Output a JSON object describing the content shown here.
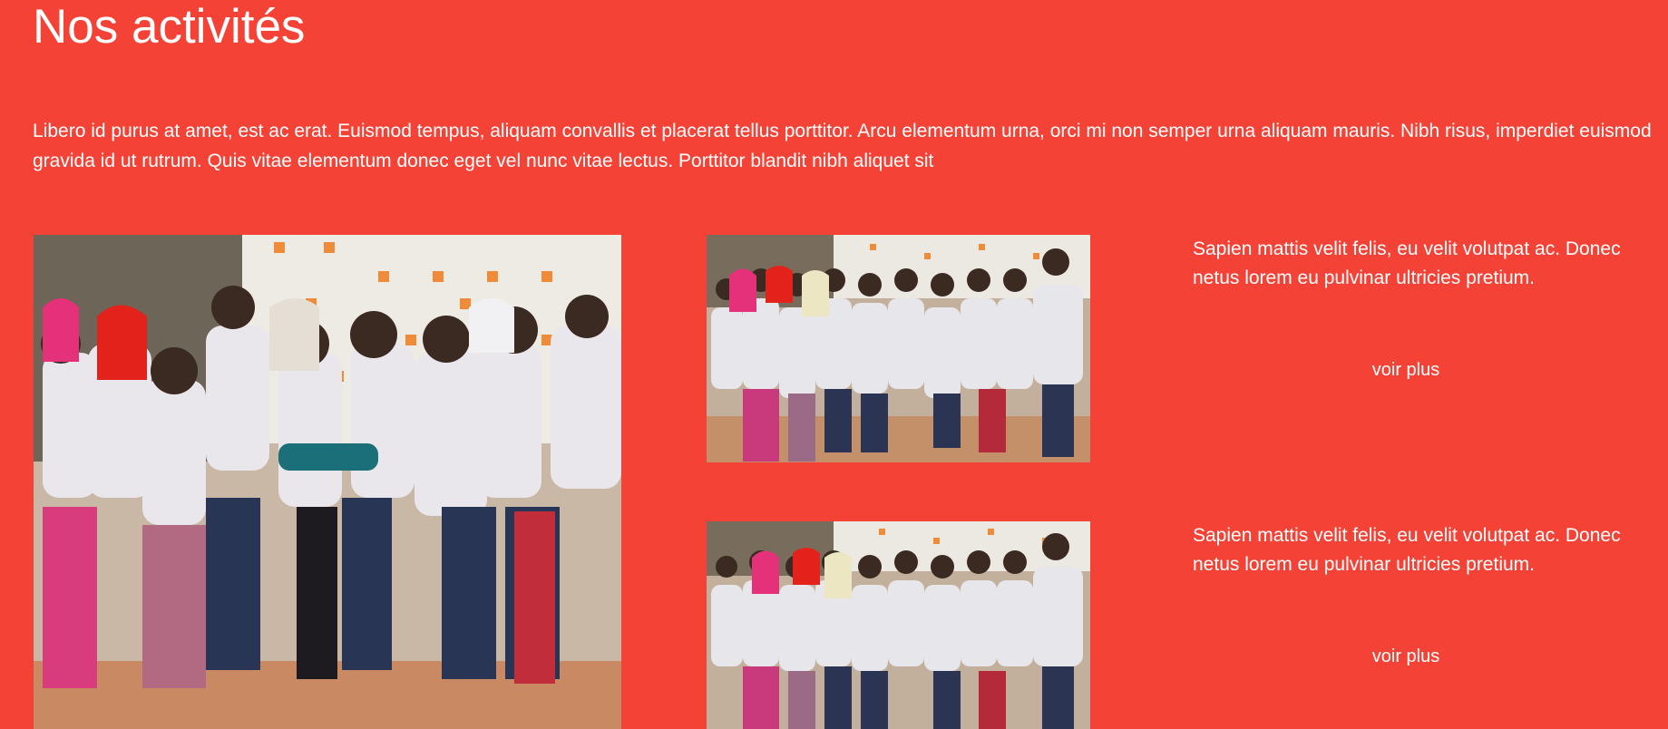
{
  "section": {
    "title": "Nos activités",
    "intro": "Libero id purus at amet, est ac erat. Euismod tempus, aliquam convallis et placerat tellus porttitor. Arcu elementum urna, orci mi non semper urna aliquam mauris. Nibh risus, imperdiet euismod gravida id ut rutrum. Quis vitae elementum donec eget vel nunc vitae lectus. Porttitor blandit nibh aliquet sit"
  },
  "activities": [
    {
      "text": "Sapien mattis velit felis, eu velit volutpat ac. Donec netus lorem eu pulvinar ultricies pretium.",
      "link": "voir plus"
    },
    {
      "text": "Sapien mattis velit felis, eu velit volutpat ac. Donec netus lorem eu pulvinar ultricies pretium.",
      "link": "voir plus"
    }
  ],
  "colors": {
    "background": "#f44336",
    "text": "#ffffff"
  }
}
